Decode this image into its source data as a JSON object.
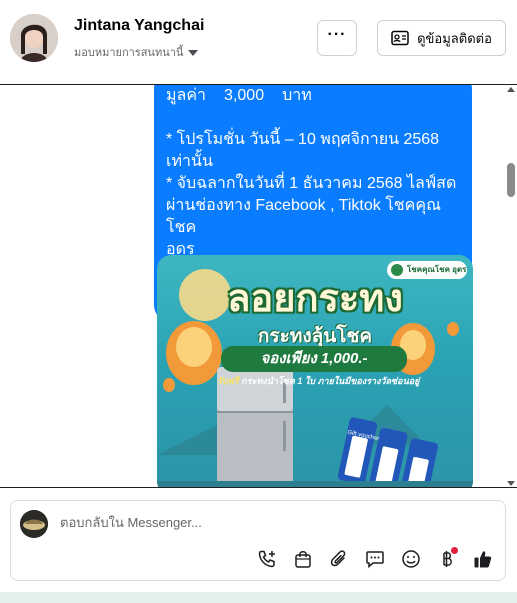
{
  "header": {
    "name": "Jintana Yangchai",
    "subline": "มอบหมายการสนทนานี้",
    "more_label": "···",
    "contact_label": "ดูข้อมูลติดต่อ",
    "icons": {
      "more": "more-dots-icon",
      "contact": "contact-card-icon",
      "assign": "chevron-down-icon"
    }
  },
  "message": {
    "price_label": "มูลค่า",
    "price_value": "3,000",
    "price_unit": "บาท",
    "line1": "* โปรโมชั่น วันนี้ – 10 พฤศจิกายน 2568",
    "line2": "เท่านั้น",
    "line3": "* จับฉลากในวันที่ 1 ธันวาคม 2568 ไลฟ์สด",
    "line4": "ผ่านช่องทาง Facebook , Tiktok โชคคุณโชค",
    "line5": "อุดร",
    "bubble_color": "#0a7cff"
  },
  "promo": {
    "title": "ลอยกระทง",
    "subtitle": "กระทงลุ้นโชค",
    "price_badge": "จองเพียง 1,000.-",
    "note_highlight": "รับฟรี",
    "note_text": "กระทงนำโชค 1 ใบ ภายในมีของรางวัลซ่อนอยู่",
    "logo_text": "โชคคุณโชค อุดรธานี",
    "voucher_text": "Gift voucher"
  },
  "composer": {
    "placeholder": "ตอบกลับใน Messenger...",
    "tools": [
      "phone-add-icon",
      "bag-icon",
      "paperclip-icon",
      "chat-bubble-icon",
      "emoji-icon",
      "baht-icon",
      "like-icon"
    ]
  },
  "colors": {
    "accent": "#0a7cff",
    "like": "#050505",
    "badge": "#e41e3f"
  }
}
